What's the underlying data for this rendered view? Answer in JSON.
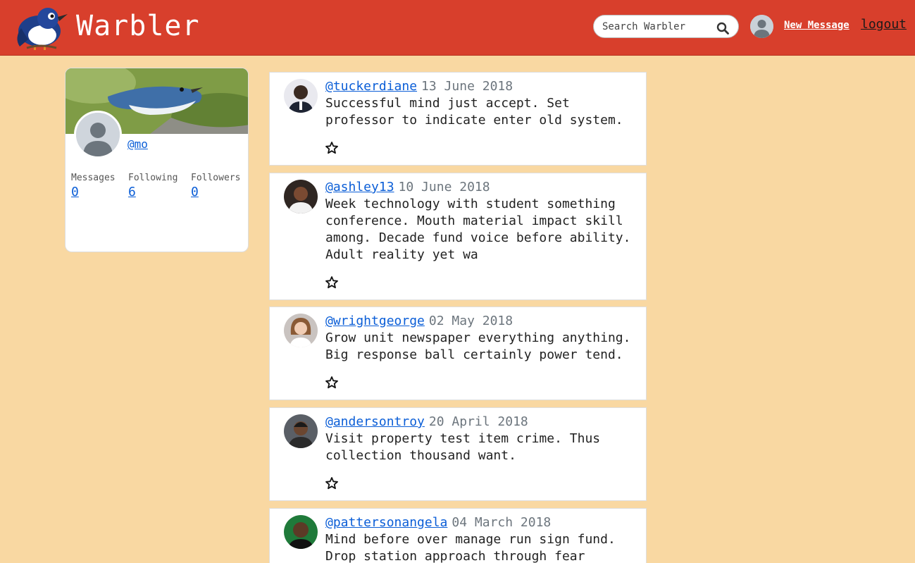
{
  "app": {
    "brand_name": "Warbler",
    "search": {
      "placeholder": "Search Warbler",
      "value": ""
    },
    "nav": {
      "new_message_label": "New Message",
      "logout_label": "logout"
    },
    "icons": {
      "logo": "warbler-bird-logo",
      "search": "search-icon",
      "avatar": "default-avatar-icon",
      "star": "star-icon"
    },
    "colors": {
      "navbar": "#d83f2c",
      "page_bg": "#f9d8a2",
      "link": "#0b5ed7"
    }
  },
  "profile": {
    "username": "@mo",
    "stats": [
      {
        "label": "Messages",
        "value": "0"
      },
      {
        "label": "Following",
        "value": "6"
      },
      {
        "label": "Followers",
        "value": "0"
      }
    ]
  },
  "messages": [
    {
      "username": "@tuckerdiane",
      "date": "13 June 2018",
      "text": "Successful mind just accept. Set\nprofessor to indicate enter old system."
    },
    {
      "username": "@ashley13",
      "date": "10 June 2018",
      "text": "Week technology with student something\nconference. Mouth material impact skill\namong. Decade fund voice before ability.\nAdult reality yet wa"
    },
    {
      "username": "@wrightgeorge",
      "date": "02 May 2018",
      "text": "Grow unit newspaper everything anything.\nBig response ball certainly power tend."
    },
    {
      "username": "@andersontroy",
      "date": "20 April 2018",
      "text": "Visit property test item crime. Thus\ncollection thousand want."
    },
    {
      "username": "@pattersonangela",
      "date": "04 March 2018",
      "text": "Mind before over manage run sign fund.\nDrop station approach through fear"
    }
  ]
}
